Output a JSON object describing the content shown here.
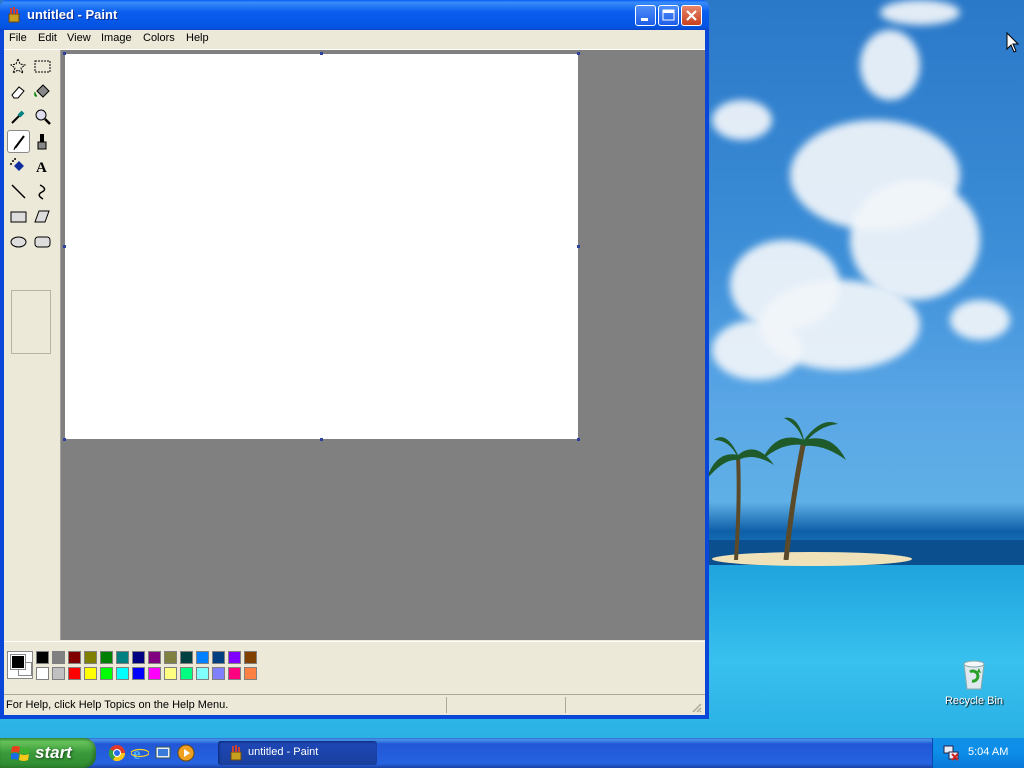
{
  "window": {
    "title": "untitled - Paint",
    "menus": [
      "File",
      "Edit",
      "View",
      "Image",
      "Colors",
      "Help"
    ]
  },
  "toolbox": {
    "tools": [
      "free-form-select",
      "select",
      "eraser",
      "fill-with-color",
      "pick-color",
      "magnifier",
      "pencil",
      "brush",
      "airbrush",
      "text",
      "line",
      "curve",
      "rectangle",
      "polygon",
      "ellipse",
      "rounded-rectangle"
    ],
    "selected": "pencil"
  },
  "palette": {
    "foreground": "#000000",
    "background": "#ffffff",
    "top_row": [
      "#000000",
      "#808080",
      "#800000",
      "#808000",
      "#008000",
      "#008080",
      "#000080",
      "#800080",
      "#808040",
      "#004040",
      "#0080ff",
      "#004080",
      "#8000ff",
      "#804000"
    ],
    "bottom_row": [
      "#ffffff",
      "#c0c0c0",
      "#ff0000",
      "#ffff00",
      "#00ff00",
      "#00ffff",
      "#0000ff",
      "#ff00ff",
      "#ffff80",
      "#00ff80",
      "#80ffff",
      "#8080ff",
      "#ff0080",
      "#ff8040"
    ]
  },
  "status": {
    "help_text": "For Help, click Help Topics on the Help Menu."
  },
  "desktop": {
    "icons": [
      {
        "label": "Recycle Bin"
      }
    ]
  },
  "taskbar": {
    "start_label": "start",
    "tasks": [
      {
        "label": "untitled - Paint"
      }
    ],
    "clock": "5:04 AM"
  }
}
